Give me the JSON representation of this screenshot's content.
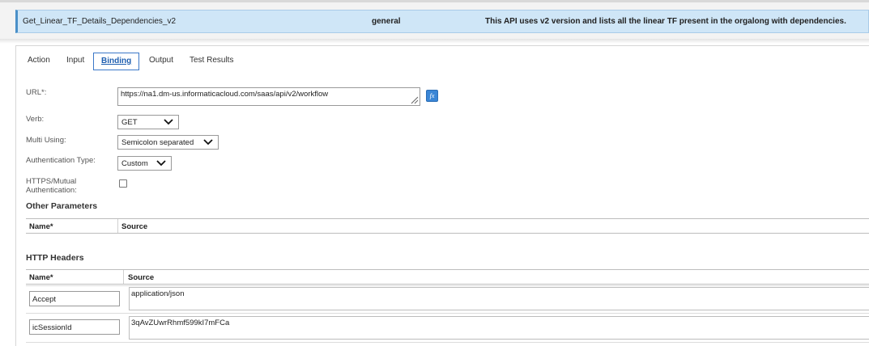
{
  "api_row": {
    "name": "Get_Linear_TF_Details_Dependencies_v2",
    "category": "general",
    "description": "This API uses v2 version and lists all the linear TF present in the orgalong with dependencies."
  },
  "tabs": [
    {
      "label": "Action"
    },
    {
      "label": "Input"
    },
    {
      "label": "Binding",
      "active": true
    },
    {
      "label": "Output"
    },
    {
      "label": "Test Results"
    }
  ],
  "binding": {
    "url_label": "URL*:",
    "url_value": "https://na1.dm-us.informaticacloud.com/saas/api/v2/workflow",
    "fx_label": "fx",
    "verb_label": "Verb:",
    "verb_value": "GET",
    "multi_label": "Multi Using:",
    "multi_value": "Semicolon separated",
    "auth_label": "Authentication Type:",
    "auth_value": "Custom",
    "https_label_line1": "HTTPS/Mutual",
    "https_label_line2": "Authentication:",
    "https_checked": false
  },
  "other_parameters": {
    "title": "Other Parameters",
    "columns": [
      "Name*",
      "Source"
    ]
  },
  "http_headers": {
    "title": "HTTP Headers",
    "columns": [
      "Name*",
      "Source"
    ],
    "rows": [
      {
        "name": "Accept",
        "source": "application/json"
      },
      {
        "name": "icSessionId",
        "source": "3qAvZUwrRhmf599kI7mFCa"
      }
    ]
  }
}
